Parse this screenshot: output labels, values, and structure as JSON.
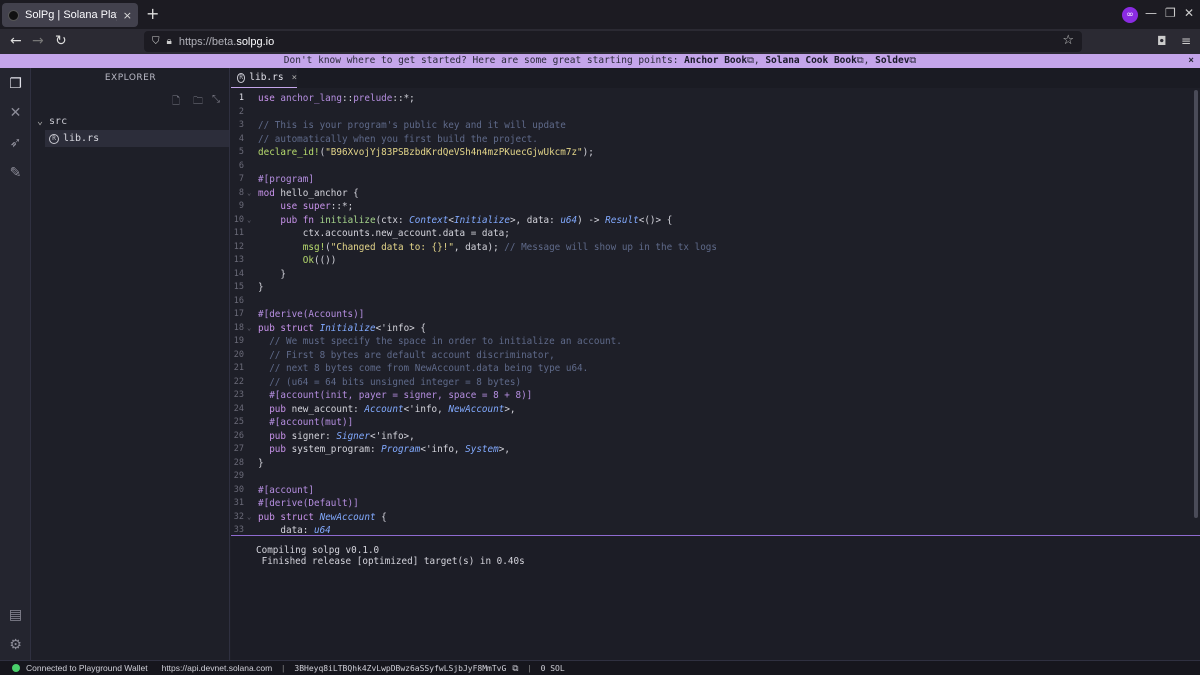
{
  "browser": {
    "tab_title": "SolPg | Solana Playground",
    "tab_close": "×",
    "new_tab": "+",
    "url_prefix": "https://beta.",
    "url_host": "solpg.io"
  },
  "banner": {
    "text": "Don't know where to get started? Here are some great starting points: ",
    "links": [
      "Anchor Book",
      "Solana Cook Book",
      "Soldev"
    ],
    "close": "×"
  },
  "explorer": {
    "title": "EXPLORER",
    "folder": "src",
    "file": "lib.rs"
  },
  "editor": {
    "tab_label": "lib.rs",
    "tab_close": "×",
    "lines": [
      {
        "n": "1",
        "h": "<span class='kw'>use</span> <span class='at'>anchor_lang</span>::<span class='at'>prelude</span>::*;"
      },
      {
        "n": "2",
        "h": ""
      },
      {
        "n": "3",
        "h": "<span class='cm'>// This is your program's public key and it will update</span>"
      },
      {
        "n": "4",
        "h": "<span class='cm'>// automatically when you first build the project.</span>"
      },
      {
        "n": "5",
        "h": "<span class='mc'>declare_id!</span>(<span class='st'>\"B96XvojYj83PSBzbdKrdQeVSh4n4mzPKuecGjwUkcm7z\"</span>);"
      },
      {
        "n": "6",
        "h": ""
      },
      {
        "n": "7",
        "h": "<span class='at'>#[program]</span>"
      },
      {
        "n": "8",
        "h": "<span class='kw'>mod</span> hello_anchor {",
        "fold": true
      },
      {
        "n": "9",
        "h": "    <span class='kw'>use</span> <span class='kw'>super</span>::*;"
      },
      {
        "n": "10",
        "h": "    <span class='kw'>pub fn</span> <span class='fn'>initialize</span>(ctx: <span class='ty'>Context</span>&lt;<span class='ty'>Initialize</span>&gt;, data: <span class='ty'>u64</span>) -&gt; <span class='ty'>Result</span>&lt;()&gt; {",
        "fold": true
      },
      {
        "n": "11",
        "h": "        ctx.accounts.new_account.data = data;"
      },
      {
        "n": "12",
        "h": "        <span class='mc'>msg!</span>(<span class='st'>\"Changed data to: {}!\"</span>, data); <span class='cm'>// Message will show up in the tx logs</span>"
      },
      {
        "n": "13",
        "h": "        <span class='mc'>Ok</span>(())"
      },
      {
        "n": "14",
        "h": "    }"
      },
      {
        "n": "15",
        "h": "}"
      },
      {
        "n": "16",
        "h": ""
      },
      {
        "n": "17",
        "h": "<span class='at'>#[derive(Accounts)]</span>"
      },
      {
        "n": "18",
        "h": "<span class='kw'>pub struct</span> <span class='ty'>Initialize</span>&lt;'info&gt; {",
        "fold": true
      },
      {
        "n": "19",
        "h": "  <span class='cm'>// We must specify the space in order to initialize an account.</span>"
      },
      {
        "n": "20",
        "h": "  <span class='cm'>// First 8 bytes are default account discriminator,</span>"
      },
      {
        "n": "21",
        "h": "  <span class='cm'>// next 8 bytes come from NewAccount.data being type u64.</span>"
      },
      {
        "n": "22",
        "h": "  <span class='cm'>// (u64 = 64 bits unsigned integer = 8 bytes)</span>"
      },
      {
        "n": "23",
        "h": "  <span class='at'>#[account(init, payer = signer, space = 8 + 8)]</span>"
      },
      {
        "n": "24",
        "h": "  <span class='kw'>pub</span> new_account: <span class='ty'>Account</span>&lt;'info, <span class='ty'>NewAccount</span>&gt;,"
      },
      {
        "n": "25",
        "h": "  <span class='at'>#[account(mut)]</span>"
      },
      {
        "n": "26",
        "h": "  <span class='kw'>pub</span> signer: <span class='ty'>Signer</span>&lt;'info&gt;,"
      },
      {
        "n": "27",
        "h": "  <span class='kw'>pub</span> system_program: <span class='ty'>Program</span>&lt;'info, <span class='ty'>System</span>&gt;,"
      },
      {
        "n": "28",
        "h": "}"
      },
      {
        "n": "29",
        "h": ""
      },
      {
        "n": "30",
        "h": "<span class='at'>#[account]</span>"
      },
      {
        "n": "31",
        "h": "<span class='at'>#[derive(Default)]</span>"
      },
      {
        "n": "32",
        "h": "<span class='kw'>pub struct</span> <span class='ty'>NewAccount</span> {",
        "fold": true
      },
      {
        "n": "33",
        "h": "    data: <span class='ty'>u64</span>"
      }
    ]
  },
  "terminal": {
    "lines": [
      "Compiling solpg v0.1.0",
      " Finished release [optimized] target(s) in 0.40s"
    ]
  },
  "status": {
    "connection": "Connected to Playground Wallet",
    "endpoint": "https://api.devnet.solana.com",
    "sep": "|",
    "wallet": "3BHeyq8iLTBQhk4ZvLwpDBwz6aSSyfwLSjbJyF8MmTvG",
    "balance": "0 SOL"
  }
}
